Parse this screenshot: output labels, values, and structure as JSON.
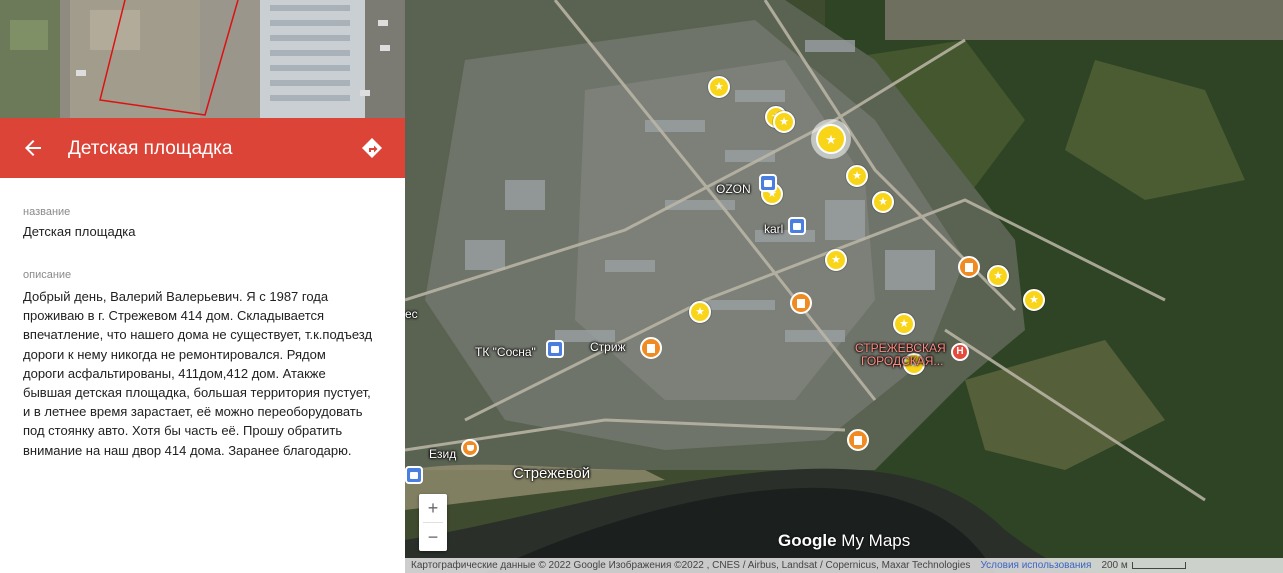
{
  "panel": {
    "title": "Детская площадка",
    "name_label": "название",
    "name_value": "Детская площадка",
    "desc_label": "описание",
    "desc_lines": [
      "Добрый день, Валерий Валерьевич. Я с 1987 года",
      "проживаю в г. Стрежевом 414 дом. Складывается",
      "впечатление, что нашего дома не существует, т.к.подъезд",
      "дороги к нему никогда не ремонтировался. Рядом",
      "дороги асфальтированы, 411дом,412 дом. Атакже",
      "бывшая детская площадка, большая территория пустует,",
      "и в летнее время зарастает, её можно переоборудовать",
      "под стоянку авто. Хотя бы часть её. Прошу обратить",
      "внимание на наш двор 414 дома. Заранее благодарю."
    ],
    "header_color": "#db4437"
  },
  "map": {
    "places": {
      "ozon": "OZON",
      "karl": "karl",
      "tk_sosna": "ТК \"Сосна\"",
      "strizh": "Стриж",
      "city": "Стрежевой",
      "ezid": "Езид",
      "hospital_1": "СТРЕЖЕВСКАЯ",
      "hospital_2": "ГОРОДСКАЯ...",
      "edge": "ec"
    },
    "zoom_in": "+",
    "zoom_out": "−",
    "logo_google": "Google",
    "logo_mymaps": " My Maps",
    "attribution": "Картографические данные © 2022 Google Изображения ©2022 , CNES / Airbus, Landsat / Copernicus, Maxar Technologies",
    "terms": "Условия использования",
    "scale": "200 м",
    "marker_color": "#f9d51a",
    "poi_color": "#ef8b22",
    "icons": [
      "star-icon",
      "building-icon",
      "shopping-bag-icon",
      "hospital-icon",
      "food-icon"
    ]
  }
}
